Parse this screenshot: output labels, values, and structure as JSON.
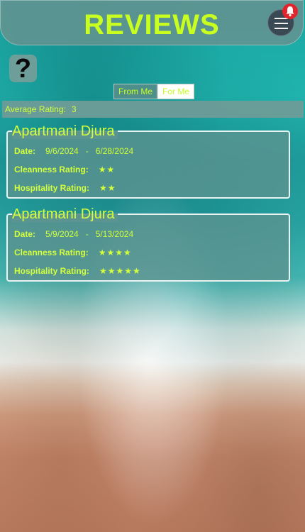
{
  "header": {
    "title": "REVIEWS"
  },
  "help": {
    "glyph": "?"
  },
  "tabs": {
    "from_me": "From Me",
    "for_me": "For Me",
    "active": "For Me"
  },
  "average": {
    "label": "Average Rating:",
    "value": "3"
  },
  "labels": {
    "date": "Date:",
    "cleanness": "Cleanness Rating:",
    "hospitality": "Hospitality Rating:",
    "separator": "-"
  },
  "reviews": [
    {
      "name": "Apartmani Djura",
      "date_from": "9/6/2024",
      "date_to": "6/28/2024",
      "cleanness_stars": "★★",
      "hospitality_stars": "★★"
    },
    {
      "name": "Apartmani Djura",
      "date_from": "5/9/2024",
      "date_to": "5/13/2024",
      "cleanness_stars": "★★★★",
      "hospitality_stars": "★★★★★"
    }
  ],
  "colors": {
    "accent": "#c8ff1e",
    "header_bg": "#609491",
    "badge": "#e0262a"
  },
  "icons": {
    "menu": "hamburger-icon",
    "notification": "bell-icon",
    "help": "question-icon"
  }
}
